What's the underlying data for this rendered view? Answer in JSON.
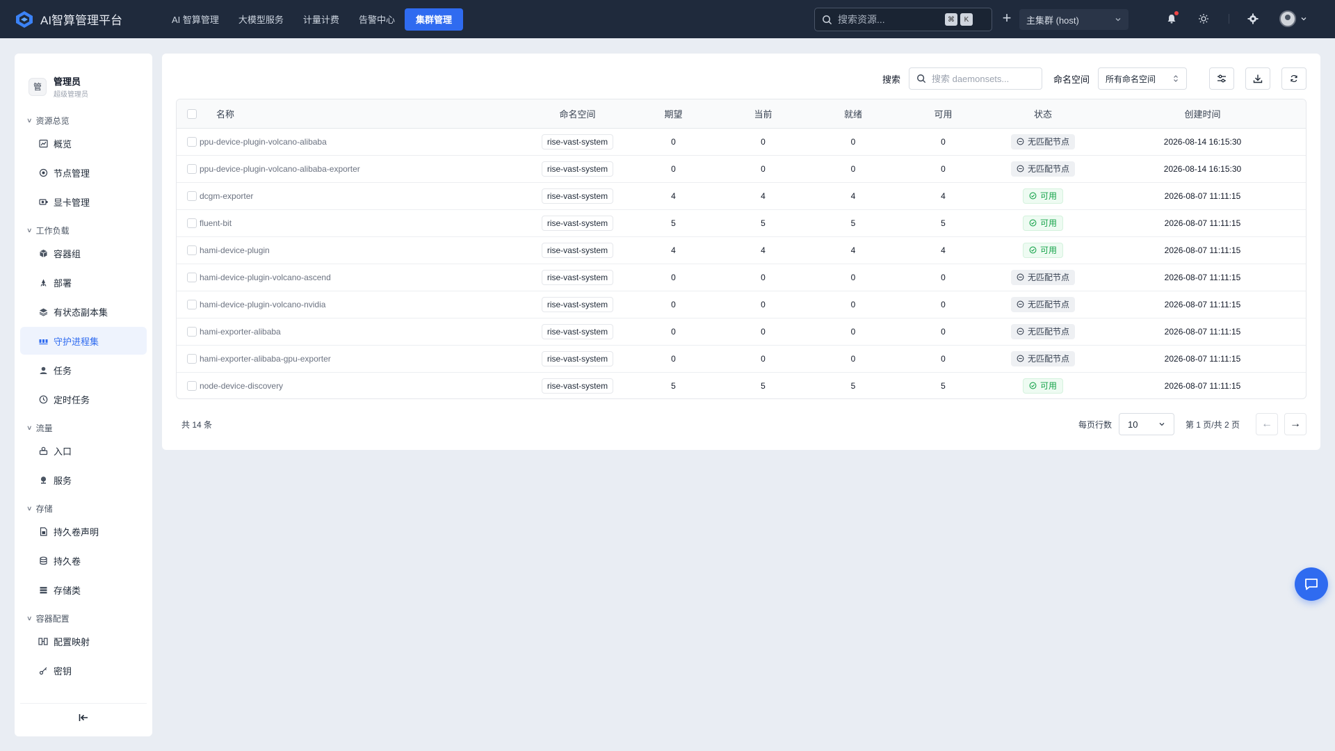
{
  "app": {
    "title": "AI智算管理平台"
  },
  "nav": {
    "items": [
      {
        "label": "AI 智算管理",
        "active": false
      },
      {
        "label": "大模型服务",
        "active": false
      },
      {
        "label": "计量计费",
        "active": false
      },
      {
        "label": "告警中心",
        "active": false
      },
      {
        "label": "集群管理",
        "active": true
      }
    ]
  },
  "top_search": {
    "placeholder": "搜索资源...",
    "kbd1": "⌘",
    "kbd2": "K"
  },
  "cluster": {
    "selected": "主集群 (host)"
  },
  "colors": {
    "accent": "#2f6bf0",
    "topbar": "#1f2a3c",
    "success": "#16a34a"
  },
  "user": {
    "avatar_char": "管",
    "name": "管理员",
    "role": "超级管理员"
  },
  "sidebar": {
    "groups": [
      {
        "label": "资源总览",
        "items": [
          {
            "label": "概览",
            "icon": "chart-icon"
          },
          {
            "label": "节点管理",
            "icon": "node-icon"
          },
          {
            "label": "显卡管理",
            "icon": "gpu-icon"
          }
        ]
      },
      {
        "label": "工作负载",
        "items": [
          {
            "label": "容器组",
            "icon": "cube-icon"
          },
          {
            "label": "部署",
            "icon": "deploy-icon"
          },
          {
            "label": "有状态副本集",
            "icon": "layers-icon"
          },
          {
            "label": "守护进程集",
            "icon": "daemon-icon",
            "active": true
          },
          {
            "label": "任务",
            "icon": "job-icon"
          },
          {
            "label": "定时任务",
            "icon": "clock-icon"
          }
        ]
      },
      {
        "label": "流量",
        "items": [
          {
            "label": "入口",
            "icon": "ingress-icon"
          },
          {
            "label": "服务",
            "icon": "service-icon"
          }
        ]
      },
      {
        "label": "存储",
        "items": [
          {
            "label": "持久卷声明",
            "icon": "pvc-icon"
          },
          {
            "label": "持久卷",
            "icon": "database-icon"
          },
          {
            "label": "存储类",
            "icon": "storage-class-icon"
          }
        ]
      },
      {
        "label": "容器配置",
        "items": [
          {
            "label": "配置映射",
            "icon": "configmap-icon"
          },
          {
            "label": "密钥",
            "icon": "key-icon"
          }
        ]
      }
    ]
  },
  "toolbar": {
    "search_label": "搜索",
    "search_placeholder": "搜索 daemonsets...",
    "namespace_label": "命名空间",
    "namespace_selected": "所有命名空间"
  },
  "table": {
    "columns": [
      "名称",
      "命名空间",
      "期望",
      "当前",
      "就绪",
      "可用",
      "状态",
      "创建时间"
    ],
    "rows": [
      {
        "name": "ppu-device-plugin-volcano-alibaba",
        "namespace": "rise-vast-system",
        "desired": "0",
        "current": "0",
        "ready": "0",
        "available": "0",
        "status": "无匹配节点",
        "status_type": "nomatch",
        "created": "2026-08-14 16:15:30"
      },
      {
        "name": "ppu-device-plugin-volcano-alibaba-exporter",
        "namespace": "rise-vast-system",
        "desired": "0",
        "current": "0",
        "ready": "0",
        "available": "0",
        "status": "无匹配节点",
        "status_type": "nomatch",
        "created": "2026-08-14 16:15:30"
      },
      {
        "name": "dcgm-exporter",
        "namespace": "rise-vast-system",
        "desired": "4",
        "current": "4",
        "ready": "4",
        "available": "4",
        "status": "可用",
        "status_type": "ok",
        "created": "2026-08-07 11:11:15"
      },
      {
        "name": "fluent-bit",
        "namespace": "rise-vast-system",
        "desired": "5",
        "current": "5",
        "ready": "5",
        "available": "5",
        "status": "可用",
        "status_type": "ok",
        "created": "2026-08-07 11:11:15"
      },
      {
        "name": "hami-device-plugin",
        "namespace": "rise-vast-system",
        "desired": "4",
        "current": "4",
        "ready": "4",
        "available": "4",
        "status": "可用",
        "status_type": "ok",
        "created": "2026-08-07 11:11:15"
      },
      {
        "name": "hami-device-plugin-volcano-ascend",
        "namespace": "rise-vast-system",
        "desired": "0",
        "current": "0",
        "ready": "0",
        "available": "0",
        "status": "无匹配节点",
        "status_type": "nomatch",
        "created": "2026-08-07 11:11:15"
      },
      {
        "name": "hami-device-plugin-volcano-nvidia",
        "namespace": "rise-vast-system",
        "desired": "0",
        "current": "0",
        "ready": "0",
        "available": "0",
        "status": "无匹配节点",
        "status_type": "nomatch",
        "created": "2026-08-07 11:11:15"
      },
      {
        "name": "hami-exporter-alibaba",
        "namespace": "rise-vast-system",
        "desired": "0",
        "current": "0",
        "ready": "0",
        "available": "0",
        "status": "无匹配节点",
        "status_type": "nomatch",
        "created": "2026-08-07 11:11:15"
      },
      {
        "name": "hami-exporter-alibaba-gpu-exporter",
        "namespace": "rise-vast-system",
        "desired": "0",
        "current": "0",
        "ready": "0",
        "available": "0",
        "status": "无匹配节点",
        "status_type": "nomatch",
        "created": "2026-08-07 11:11:15"
      },
      {
        "name": "node-device-discovery",
        "namespace": "rise-vast-system",
        "desired": "5",
        "current": "5",
        "ready": "5",
        "available": "5",
        "status": "可用",
        "status_type": "ok",
        "created": "2026-08-07 11:11:15"
      }
    ]
  },
  "pagination": {
    "total": "共 14 条",
    "page_size_label": "每页行数",
    "page_size": "10",
    "page_info": "第 1 页/共 2 页"
  }
}
